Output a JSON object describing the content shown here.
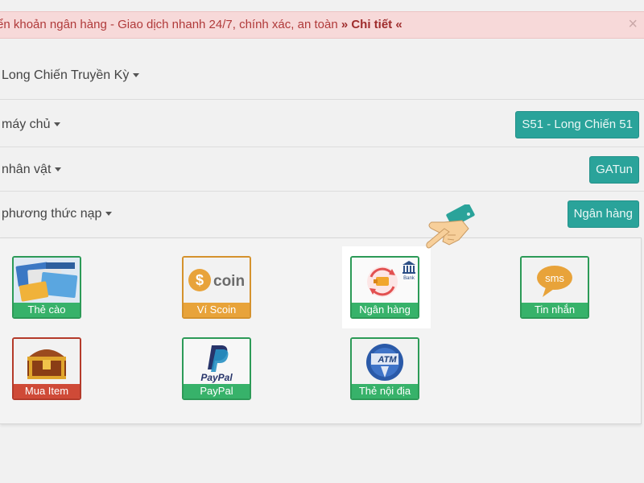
{
  "banner": {
    "text_prefix": "ển khoản ngân hàng - Giao dịch nhanh 24/7, chính xác, an toàn",
    "link": "» Chi tiết «",
    "close": "×"
  },
  "game_select": {
    "label": "Long Chiến Truyền Kỳ"
  },
  "server": {
    "label": "máy chủ",
    "value": "S51 - Long Chiến 51"
  },
  "character": {
    "label": "nhân vật",
    "value": "GATun"
  },
  "method": {
    "label": "phương thức nạp",
    "value": "Ngân hàng"
  },
  "payment_methods": [
    {
      "label": "Thẻ cào",
      "icon": "scratch-card-icon"
    },
    {
      "label": "Ví Scoin",
      "icon": "scoin-icon",
      "brand": "coin"
    },
    {
      "label": "Ngân hàng",
      "icon": "bank-icon",
      "badge": "Bank"
    },
    {
      "label": "Tin nhắn",
      "icon": "sms-icon",
      "badge": "sms"
    },
    {
      "label": "Mua Item",
      "icon": "treasure-chest-icon"
    },
    {
      "label": "PayPal",
      "icon": "paypal-icon",
      "brand": "PayPal"
    },
    {
      "label": "Thẻ nội địa",
      "icon": "atm-card-icon",
      "badge": "ATM"
    }
  ],
  "colors": {
    "teal": "#2aa39a",
    "green": "#37b26a",
    "orange": "#e8a33a",
    "red": "#cf4a37"
  }
}
